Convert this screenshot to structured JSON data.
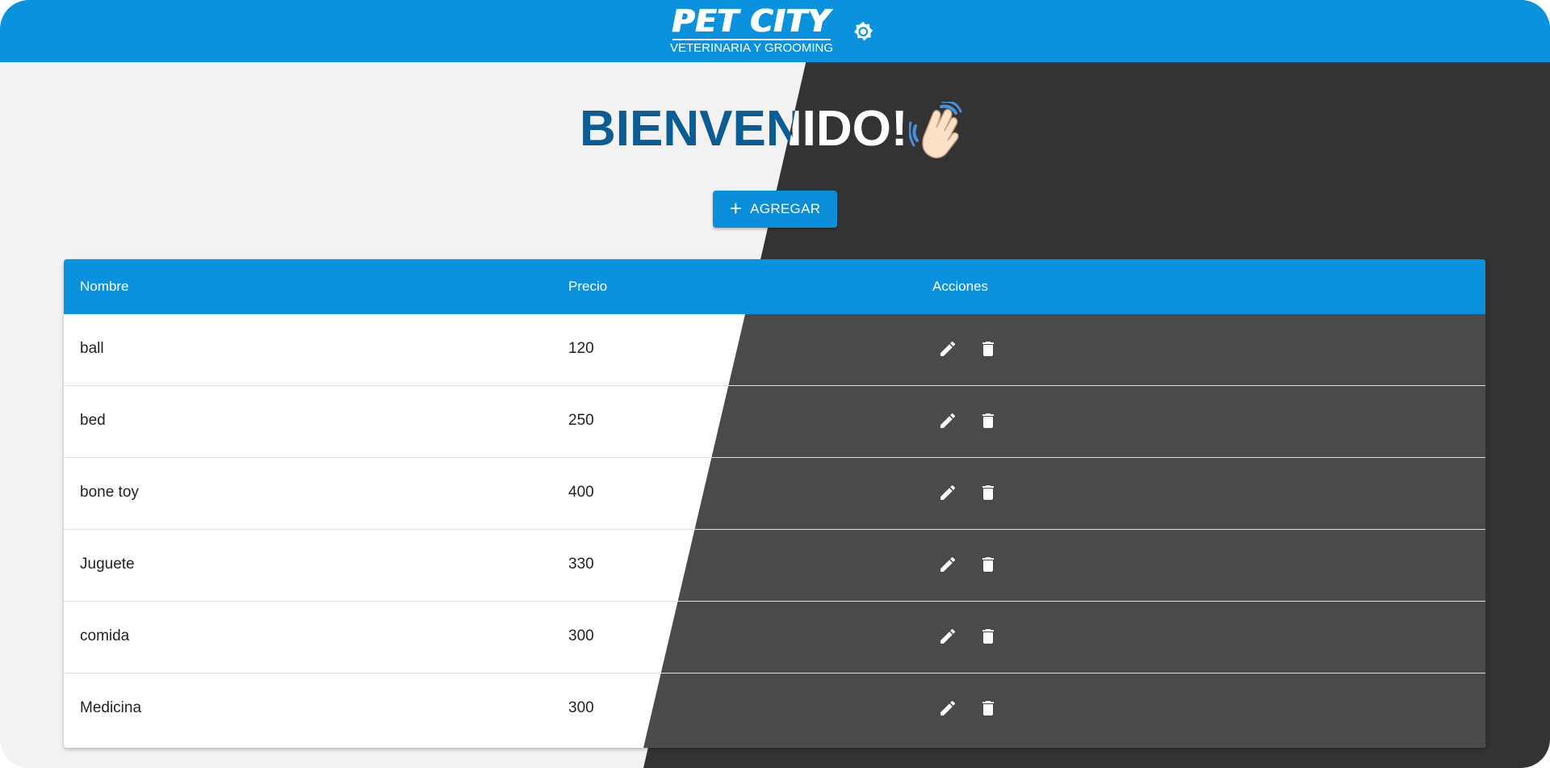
{
  "header": {
    "logo_title": "PET CITY",
    "logo_subtitle": "VETERINARIA Y GROOMING",
    "settings_icon": "gear-icon"
  },
  "welcome": {
    "title": "BIENVENIDO!",
    "emoji_icon": "waving-hand-icon"
  },
  "toolbar": {
    "add_label": "AGREGAR",
    "add_icon": "plus-icon"
  },
  "colors": {
    "primary": "#0b92de",
    "title_blue": "#0b5c92",
    "dark_bg": "#333333",
    "light_bg": "#f2f2f2"
  },
  "table": {
    "columns": [
      "Nombre",
      "Precio",
      "Acciones"
    ],
    "rows": [
      {
        "name": "ball",
        "price": "120"
      },
      {
        "name": "bed",
        "price": "250"
      },
      {
        "name": "bone toy",
        "price": "400"
      },
      {
        "name": "Juguete",
        "price": "330"
      },
      {
        "name": "comida",
        "price": "300"
      },
      {
        "name": "Medicina",
        "price": "300"
      }
    ],
    "row_actions": [
      "edit-icon",
      "delete-icon"
    ]
  }
}
